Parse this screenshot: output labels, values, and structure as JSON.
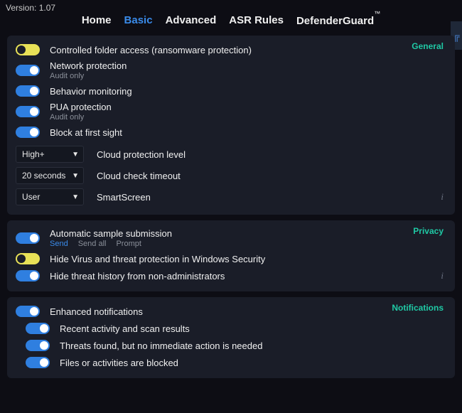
{
  "version_label": "Version: 1.07",
  "tabs": {
    "home": "Home",
    "basic": "Basic",
    "advanced": "Advanced",
    "asr": "ASR Rules",
    "defender": "DefenderGuard",
    "tm": "™"
  },
  "sections": {
    "general": "General",
    "privacy": "Privacy",
    "notifications": "Notifications"
  },
  "general": {
    "controlled_folder": "Controlled folder access (ransomware protection)",
    "network_protection": "Network protection",
    "network_sub": "Audit only",
    "behavior": "Behavior monitoring",
    "pua": "PUA protection",
    "pua_sub": "Audit only",
    "block_first_sight": "Block at first sight",
    "cloud_level_value": "High+",
    "cloud_level_label": "Cloud protection level",
    "cloud_timeout_value": "20 seconds",
    "cloud_timeout_label": "Cloud check timeout",
    "smartscreen_value": "User",
    "smartscreen_label": "SmartScreen"
  },
  "privacy": {
    "auto_sample": "Automatic sample submission",
    "sub_send": "Send",
    "sub_sendall": "Send all",
    "sub_prompt": "Prompt",
    "hide_virus": "Hide Virus and threat protection in Windows Security",
    "hide_history": "Hide threat history from non-administrators"
  },
  "notifications": {
    "enhanced": "Enhanced notifications",
    "recent": "Recent activity and scan results",
    "threats_found": "Threats found, but no immediate action is needed",
    "files_blocked": "Files or activities are blocked"
  },
  "glyphs": {
    "chevron_down": "▼",
    "info": "i",
    "loop": "╔"
  }
}
